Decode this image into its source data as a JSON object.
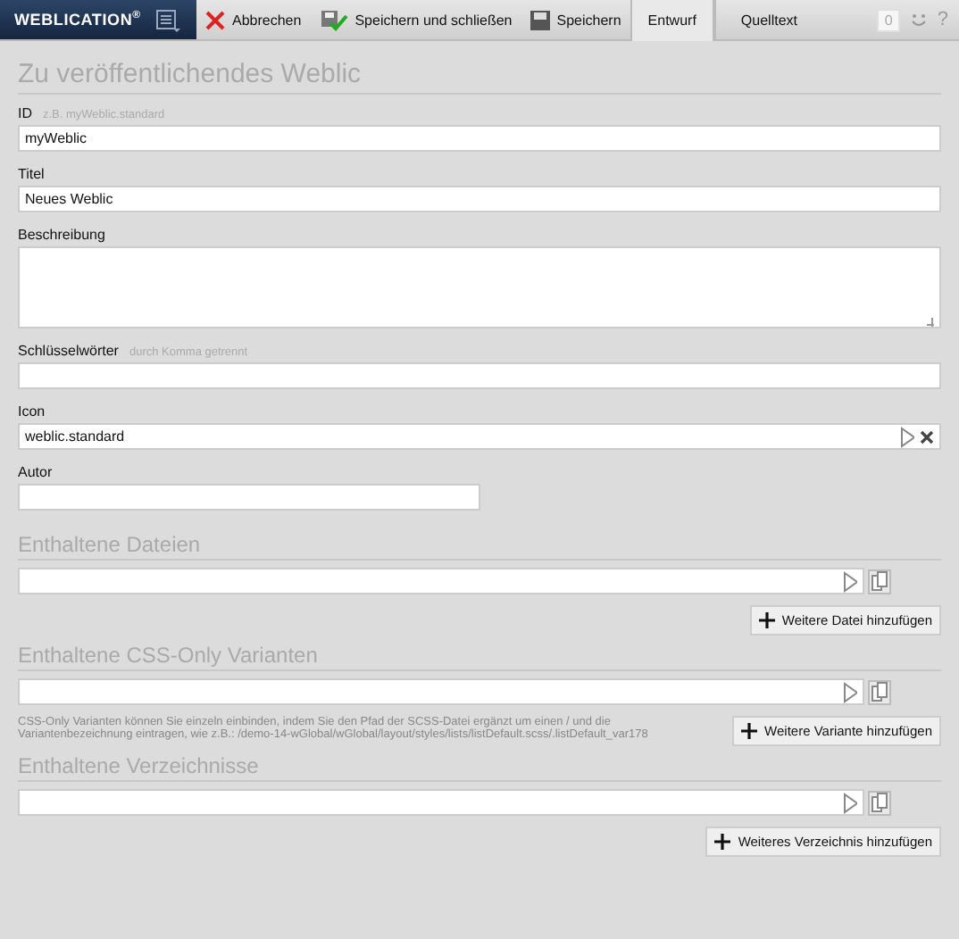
{
  "toolbar": {
    "logo": "WEBLICATION$^{®}$",
    "actions": [
      {
        "kind": "cancel",
        "label": "Abbrechen"
      },
      {
        "kind": "save-close",
        "label": "Speichern und schließen"
      },
      {
        "kind": "save",
        "label": "Speichern"
      }
    ],
    "tabs": [
      {
        "label": "Entwurf",
        "selected": true
      },
      {
        "label": "Quelltext",
        "selected": false
      }
    ],
    "counter": "0",
    "help": "?"
  },
  "title": "Zu veröffentlichendes Weblic",
  "fields": [
    {
      "kind": "text",
      "label": "ID",
      "hint": "z.B. myWeblic.standard",
      "value": "myWeblic"
    },
    {
      "kind": "text",
      "label": "Titel",
      "value": "Neues Weblic"
    },
    {
      "kind": "textarea",
      "label": "Beschreibung"
    },
    {
      "kind": "text",
      "label": "Schlüsselwörter",
      "hint": "durch Komma getrennt"
    },
    {
      "kind": "picker",
      "label": "Icon",
      "value": "weblic.standard"
    },
    {
      "kind": "short",
      "label": "Autor"
    }
  ],
  "sections": [
    {
      "title": "Enthaltene Dateien",
      "button": "Weitere Datei hinzufügen"
    },
    {
      "title": "Enthaltene CSS-Only Varianten",
      "note": "CSS-Only Varianten können Sie einzeln einbinden, indem Sie den Pfad der SCSS-Datei ergänzt um einen / und die Variantenbezeichnung eintragen, wie z.B.: /demo-14-wGlobal/wGlobal/layout/styles/lists/listDefault.scss/.listDefault_var178",
      "button": "Weitere Variante hinzufügen"
    },
    {
      "title": "Enthaltene Verzeichnisse",
      "button": "Weiteres Verzeichnis hinzufügen"
    }
  ]
}
